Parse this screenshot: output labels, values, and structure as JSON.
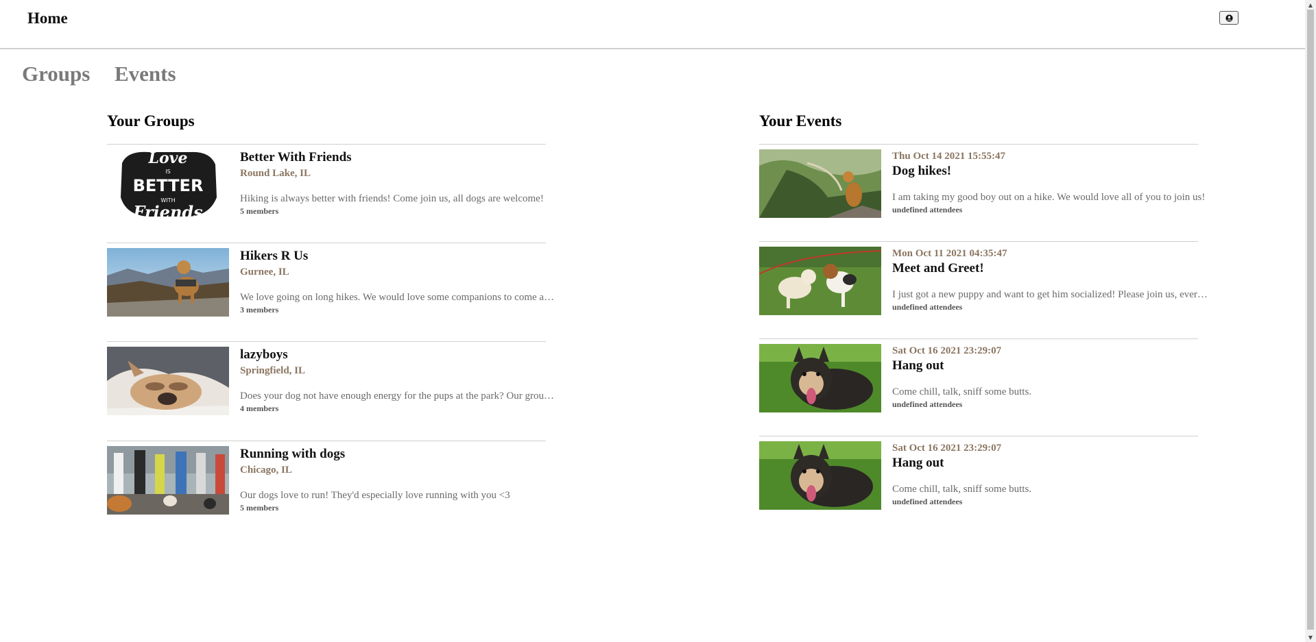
{
  "header": {
    "home_label": "Home",
    "profile_icon": "user-circle-icon"
  },
  "nav": {
    "tabs": [
      {
        "label": "Groups"
      },
      {
        "label": "Events"
      }
    ]
  },
  "groups": {
    "title": "Your Groups",
    "items": [
      {
        "name": "Better With Friends",
        "location": "Round Lake, IL",
        "description": "Hiking is always better with friends! Come join us, all dogs are welcome!",
        "members": "5 members",
        "image": "love-is-better-with-friends-lettering"
      },
      {
        "name": "Hikers R Us",
        "location": "Gurnee, IL",
        "description": "We love going on long hikes. We would love some companions to come along!",
        "members": "3 members",
        "image": "dog-on-mountain-photo"
      },
      {
        "name": "lazyboys",
        "location": "Springfield, IL",
        "description": "Does your dog not have enough energy for the pups at the park? Our group is for you!",
        "members": "4 members",
        "image": "sleeping-french-bulldog-photo"
      },
      {
        "name": "Running with dogs",
        "location": "Chicago, IL",
        "description": "Our dogs love to run! They'd especially love running with you <3",
        "members": "5 members",
        "image": "runners-with-dogs-photo"
      }
    ]
  },
  "events": {
    "title": "Your Events",
    "items": [
      {
        "date": "Thu Oct 14 2021 15:55:47",
        "name": "Dog hikes!",
        "description": "I am taking my good boy out on a hike. We would love all of you to join us!",
        "attendees": "undefined attendees",
        "image": "dog-on-hillside-photo"
      },
      {
        "date": "Mon Oct 11 2021 04:35:47",
        "name": "Meet and Greet!",
        "description": "I just got a new puppy and want to get him socialized! Please join us, everyone is welcome!",
        "attendees": "undefined attendees",
        "image": "two-puppies-on-grass-photo"
      },
      {
        "date": "Sat Oct 16 2021 23:29:07",
        "name": "Hang out",
        "description": "Come chill, talk, sniff some butts.",
        "attendees": "undefined attendees",
        "image": "happy-dog-on-grass-photo"
      },
      {
        "date": "Sat Oct 16 2021 23:29:07",
        "name": "Hang out",
        "description": "Come chill, talk, sniff some butts.",
        "attendees": "undefined attendees",
        "image": "happy-dog-on-grass-photo"
      }
    ]
  }
}
